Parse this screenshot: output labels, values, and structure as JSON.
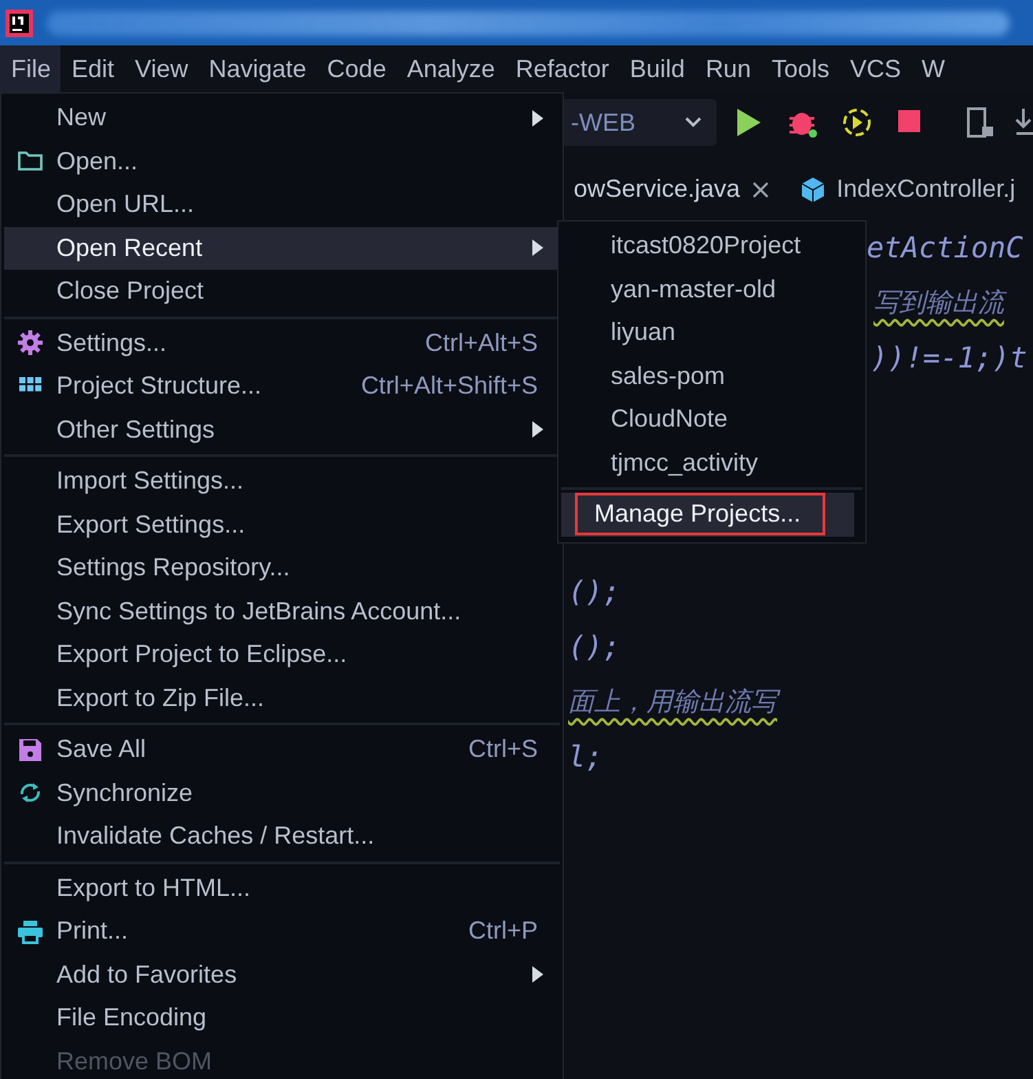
{
  "menubar": [
    {
      "label": "File",
      "selected": true
    },
    {
      "label": "Edit",
      "selected": false
    },
    {
      "label": "View",
      "selected": false
    },
    {
      "label": "Navigate",
      "selected": false
    },
    {
      "label": "Code",
      "selected": false
    },
    {
      "label": "Analyze",
      "selected": false
    },
    {
      "label": "Refactor",
      "selected": false
    },
    {
      "label": "Build",
      "selected": false
    },
    {
      "label": "Run",
      "selected": false
    },
    {
      "label": "Tools",
      "selected": false
    },
    {
      "label": "VCS",
      "selected": false
    },
    {
      "label": "W",
      "selected": false
    }
  ],
  "toolbar": {
    "run_config": "-WEB"
  },
  "editor_tabs": [
    {
      "label": "owService.java",
      "selected": true,
      "closable": true
    },
    {
      "label": "IndexController.j",
      "selected": false,
      "closable": false
    }
  ],
  "code_lines": [
    {
      "text": "etActionC",
      "kind": "code"
    },
    {
      "text": "写到输出流",
      "kind": "comment"
    },
    {
      "text": "))!=-1;)t",
      "kind": "code"
    },
    {
      "text": "();",
      "kind": "code"
    },
    {
      "text": "();",
      "kind": "code"
    },
    {
      "text": "面上，用输出流写",
      "kind": "comment"
    },
    {
      "text": "l;",
      "kind": "code"
    }
  ],
  "file_menu": [
    {
      "kind": "item",
      "label": "New",
      "submenu": true,
      "selected": false
    },
    {
      "kind": "folder",
      "label": "Open...",
      "selected": false
    },
    {
      "kind": "item",
      "label": "Open URL...",
      "selected": false
    },
    {
      "kind": "item",
      "label": "Open Recent",
      "submenu": true,
      "selected": true
    },
    {
      "kind": "item",
      "label": "Close Project",
      "selected": false
    },
    {
      "kind": "separator"
    },
    {
      "kind": "gear",
      "label": "Settings...",
      "shortcut": "Ctrl+Alt+S",
      "selected": false
    },
    {
      "kind": "grid",
      "label": "Project Structure...",
      "shortcut": "Ctrl+Alt+Shift+S",
      "selected": false
    },
    {
      "kind": "item",
      "label": "Other Settings",
      "submenu": true,
      "selected": false
    },
    {
      "kind": "separator"
    },
    {
      "kind": "item",
      "label": "Import Settings...",
      "selected": false
    },
    {
      "kind": "item",
      "label": "Export Settings...",
      "selected": false
    },
    {
      "kind": "item",
      "label": "Settings Repository...",
      "selected": false
    },
    {
      "kind": "item",
      "label": "Sync Settings to JetBrains Account...",
      "selected": false
    },
    {
      "kind": "item",
      "label": "Export Project to Eclipse...",
      "selected": false
    },
    {
      "kind": "item",
      "label": "Export to Zip File...",
      "selected": false
    },
    {
      "kind": "separator"
    },
    {
      "kind": "save",
      "label": "Save All",
      "shortcut": "Ctrl+S",
      "selected": false
    },
    {
      "kind": "sync",
      "label": "Synchronize",
      "selected": false
    },
    {
      "kind": "item",
      "label": "Invalidate Caches / Restart...",
      "selected": false
    },
    {
      "kind": "separator"
    },
    {
      "kind": "item",
      "label": "Export to HTML...",
      "selected": false
    },
    {
      "kind": "printer",
      "label": "Print...",
      "shortcut": "Ctrl+P",
      "selected": false
    },
    {
      "kind": "item",
      "label": "Add to Favorites",
      "submenu": true,
      "selected": false
    },
    {
      "kind": "item",
      "label": "File Encoding",
      "selected": false
    },
    {
      "kind": "item",
      "label": "Remove BOM",
      "disabled": true,
      "selected": false
    }
  ],
  "recent_menu": [
    {
      "kind": "item",
      "label": "itcast0820Project",
      "selected": false
    },
    {
      "kind": "item",
      "label": "yan-master-old",
      "selected": false
    },
    {
      "kind": "item",
      "label": "liyuan",
      "selected": false
    },
    {
      "kind": "item",
      "label": "sales-pom",
      "selected": false
    },
    {
      "kind": "item",
      "label": "CloudNote",
      "selected": false
    },
    {
      "kind": "item",
      "label": "tjmcc_activity",
      "selected": false
    },
    {
      "kind": "separator"
    },
    {
      "kind": "item",
      "label": "Manage Projects...",
      "selected": true,
      "outlined": true
    }
  ]
}
